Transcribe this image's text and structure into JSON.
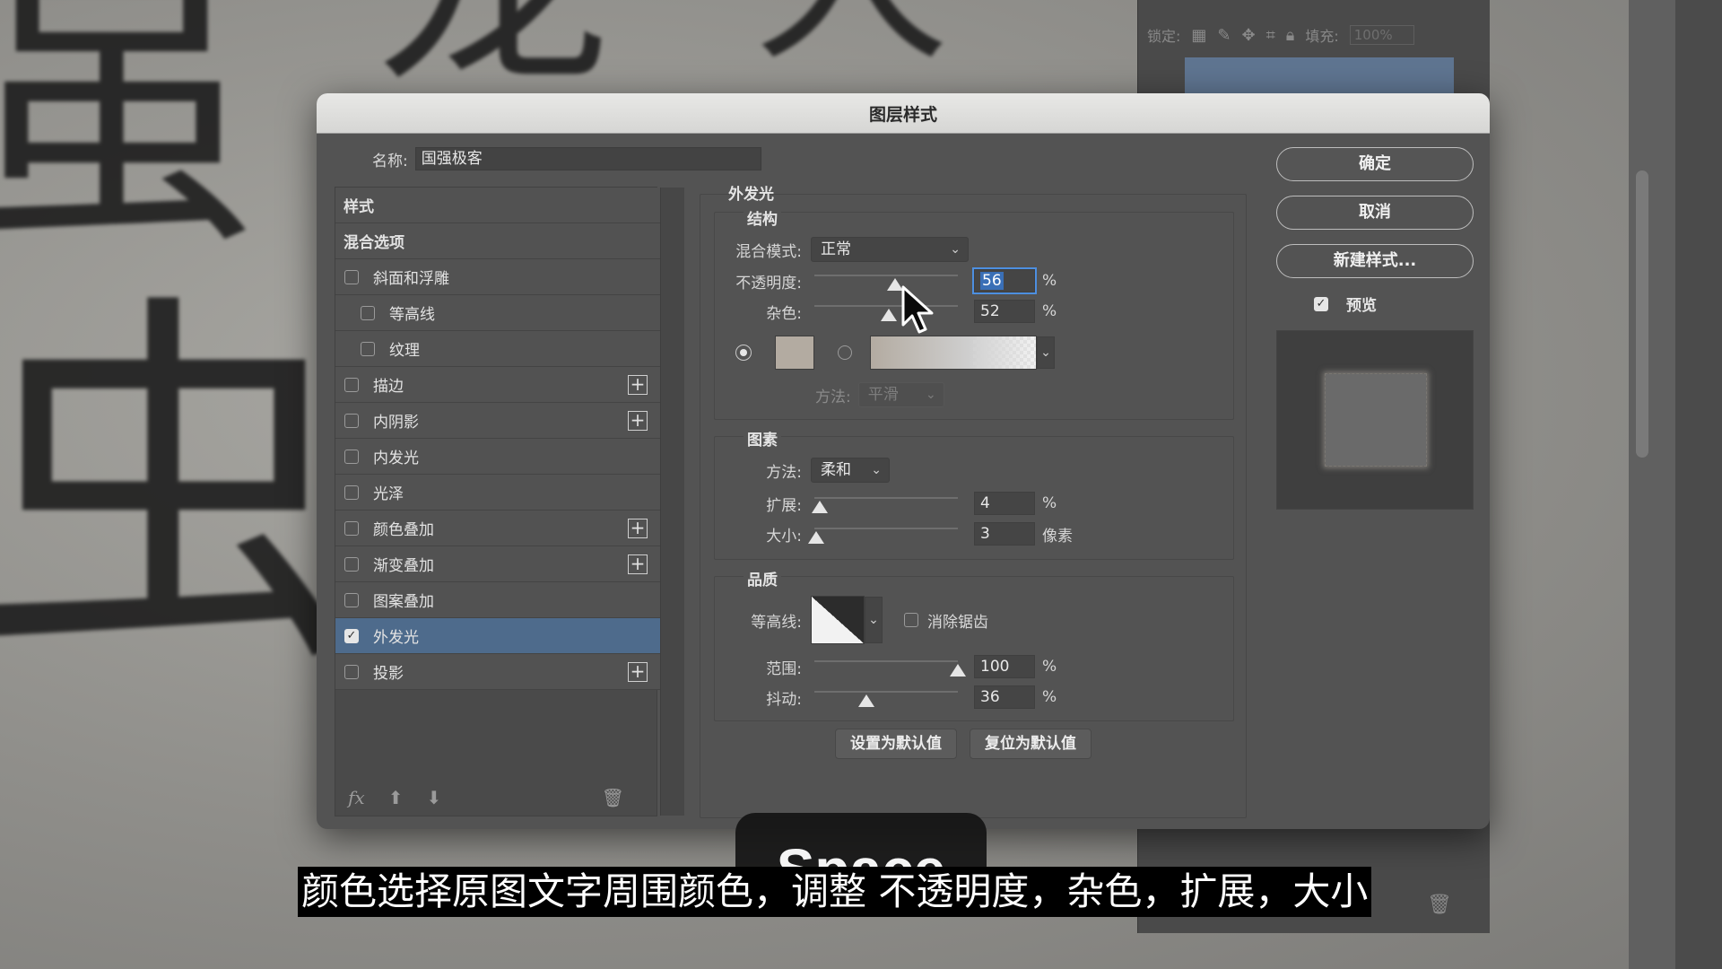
{
  "dialog": {
    "title": "图层样式",
    "name_label": "名称:",
    "name_value": "国强极客"
  },
  "style_list": {
    "header": "样式",
    "blend_options": "混合选项",
    "items": [
      {
        "label": "斜面和浮雕",
        "checked": false,
        "sub": false,
        "plus": false
      },
      {
        "label": "等高线",
        "checked": false,
        "sub": true,
        "plus": false
      },
      {
        "label": "纹理",
        "checked": false,
        "sub": true,
        "plus": false
      },
      {
        "label": "描边",
        "checked": false,
        "sub": false,
        "plus": true
      },
      {
        "label": "内阴影",
        "checked": false,
        "sub": false,
        "plus": true
      },
      {
        "label": "内发光",
        "checked": false,
        "sub": false,
        "plus": false
      },
      {
        "label": "光泽",
        "checked": false,
        "sub": false,
        "plus": false
      },
      {
        "label": "颜色叠加",
        "checked": false,
        "sub": false,
        "plus": true
      },
      {
        "label": "渐变叠加",
        "checked": false,
        "sub": false,
        "plus": true
      },
      {
        "label": "图案叠加",
        "checked": false,
        "sub": false,
        "plus": false
      },
      {
        "label": "外发光",
        "checked": true,
        "sub": false,
        "plus": false,
        "selected": true
      },
      {
        "label": "投影",
        "checked": false,
        "sub": false,
        "plus": true
      }
    ],
    "footer_fx": "fx"
  },
  "outer_glow": {
    "title": "外发光",
    "structure": {
      "title": "结构",
      "blend_mode_label": "混合模式:",
      "blend_mode_value": "正常",
      "opacity_label": "不透明度:",
      "opacity_value": "56",
      "opacity_unit": "%",
      "opacity_level": 0.56,
      "noise_label": "杂色:",
      "noise_value": "52",
      "noise_unit": "%",
      "noise_level": 0.52,
      "method_label": "方法:",
      "method_value": "平滑",
      "glow_color": "#b3aba1"
    },
    "elements": {
      "title": "图素",
      "technique_label": "方法:",
      "technique_value": "柔和",
      "spread_label": "扩展:",
      "spread_value": "4",
      "spread_unit": "%",
      "spread_level": 0.04,
      "size_label": "大小:",
      "size_value": "3",
      "size_unit": "像素",
      "size_level": 0.012
    },
    "quality": {
      "title": "品质",
      "contour_label": "等高线:",
      "antialias_label": "消除锯齿",
      "range_label": "范围:",
      "range_value": "100",
      "range_unit": "%",
      "range_level": 1.0,
      "jitter_label": "抖动:",
      "jitter_value": "36",
      "jitter_unit": "%",
      "jitter_level": 0.36
    },
    "set_default_label": "设置为默认值",
    "reset_default_label": "复位为默认值"
  },
  "actions": {
    "ok_label": "确定",
    "cancel_label": "取消",
    "new_style_label": "新建样式...",
    "preview_label": "预览",
    "preview_checked": true
  },
  "background": {
    "lock_label": "锁定:",
    "fill_label": "填充:",
    "fill_value": "100%"
  },
  "overlay": {
    "key_label": "Space",
    "subtitle": "颜色选择原图文字周围颜色，调整 不透明度，杂色，扩展，大小"
  },
  "colors": {
    "accent_selected": "#4e6b8c",
    "focus": "#4d8fe0",
    "dialog_bg": "#535353"
  }
}
